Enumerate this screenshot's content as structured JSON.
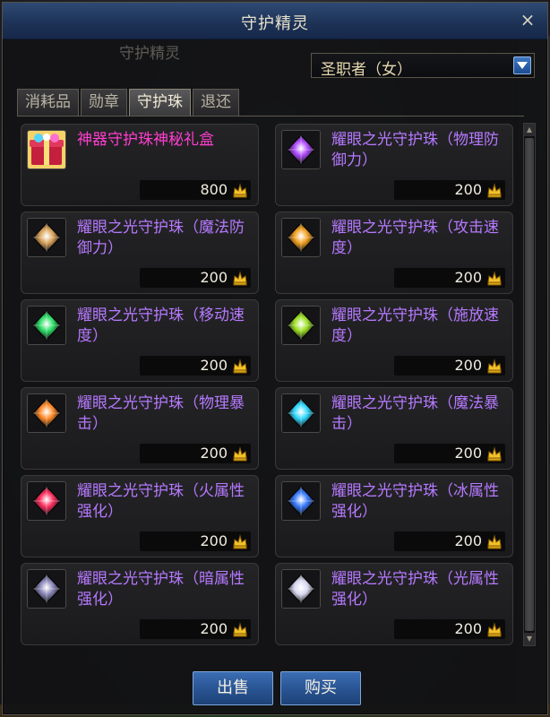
{
  "window": {
    "title": "守护精灵",
    "close_symbol": "×"
  },
  "background_label": "守护精灵",
  "class_selector": {
    "value": "圣职者（女）"
  },
  "tabs": [
    {
      "label": "消耗品",
      "active": false
    },
    {
      "label": "勋章",
      "active": false
    },
    {
      "label": "守护珠",
      "active": true
    },
    {
      "label": "退还",
      "active": false
    }
  ],
  "items": [
    {
      "name": "神器守护珠神秘礼盒",
      "price": "800",
      "name_color": "#ff3ecf",
      "icon": "gift-box-icon",
      "gem_color": ""
    },
    {
      "name": "耀眼之光守护珠（物理防御力）",
      "price": "200",
      "name_color": "#b679ff",
      "icon": "purple-gem-icon",
      "gem_color": "#b04cff"
    },
    {
      "name": "耀眼之光守护珠（魔法防御力）",
      "price": "200",
      "name_color": "#b679ff",
      "icon": "amber-gem-icon",
      "gem_color": "#d9a35a"
    },
    {
      "name": "耀眼之光守护珠（攻击速度）",
      "price": "200",
      "name_color": "#b679ff",
      "icon": "orange-gem-icon",
      "gem_color": "#f0a020"
    },
    {
      "name": "耀眼之光守护珠（移动速度）",
      "price": "200",
      "name_color": "#b679ff",
      "icon": "green-gem-icon",
      "gem_color": "#2fe06a"
    },
    {
      "name": "耀眼之光守护珠（施放速度）",
      "price": "200",
      "name_color": "#b679ff",
      "icon": "lime-gem-icon",
      "gem_color": "#9be024"
    },
    {
      "name": "耀眼之光守护珠（物理暴击）",
      "price": "200",
      "name_color": "#b679ff",
      "icon": "orange-gem-icon",
      "gem_color": "#ff8a28"
    },
    {
      "name": "耀眼之光守护珠（魔法暴击）",
      "price": "200",
      "name_color": "#b679ff",
      "icon": "cyan-gem-icon",
      "gem_color": "#30d8ff"
    },
    {
      "name": "耀眼之光守护珠（火属性强化）",
      "price": "200",
      "name_color": "#b679ff",
      "icon": "red-gem-icon",
      "gem_color": "#ff3060"
    },
    {
      "name": "耀眼之光守护珠（冰属性强化）",
      "price": "200",
      "name_color": "#b679ff",
      "icon": "blue-gem-icon",
      "gem_color": "#3a7cff"
    },
    {
      "name": "耀眼之光守护珠（暗属性强化）",
      "price": "200",
      "name_color": "#b679ff",
      "icon": "dark-gem-icon",
      "gem_color": "#8a86b8"
    },
    {
      "name": "耀眼之光守护珠（光属性强化）",
      "price": "200",
      "name_color": "#b679ff",
      "icon": "white-gem-icon",
      "gem_color": "#d8d8f0"
    }
  ],
  "buttons": {
    "sell": "出售",
    "buy": "购买"
  }
}
